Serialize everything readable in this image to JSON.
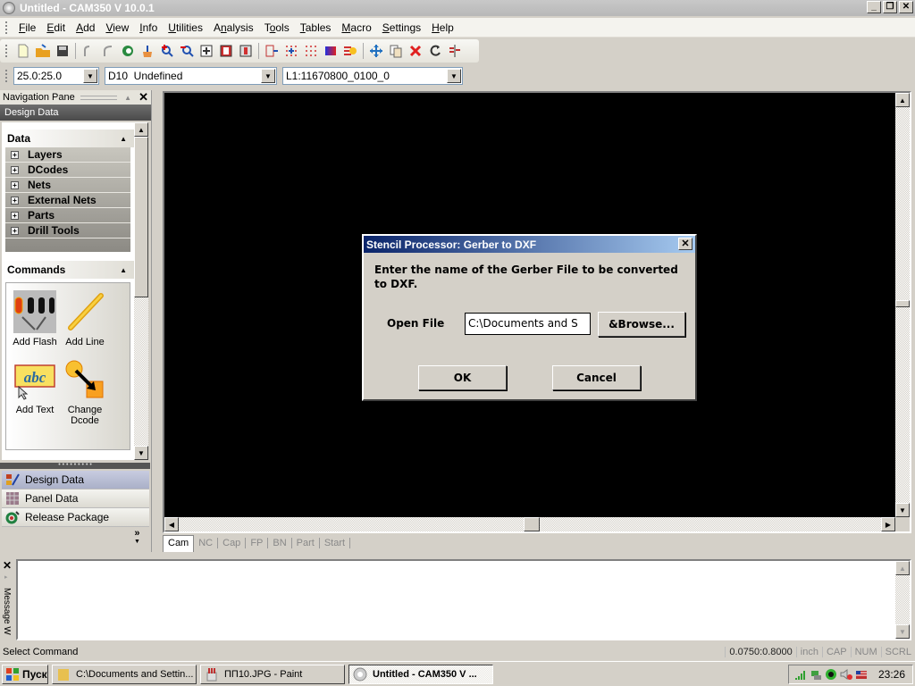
{
  "window": {
    "title": "Untitled - CAM350 V 10.0.1",
    "controls": {
      "minimize": "_",
      "restore": "❐",
      "close": "✕"
    }
  },
  "menu": [
    {
      "label": "File",
      "accel": "F"
    },
    {
      "label": "Edit",
      "accel": "E"
    },
    {
      "label": "Add",
      "accel": "A"
    },
    {
      "label": "View",
      "accel": "V"
    },
    {
      "label": "Info",
      "accel": "I"
    },
    {
      "label": "Utilities",
      "accel": "U"
    },
    {
      "label": "Analysis",
      "accel": "n"
    },
    {
      "label": "Tools",
      "accel": "o"
    },
    {
      "label": "Tables",
      "accel": "T"
    },
    {
      "label": "Macro",
      "accel": "M"
    },
    {
      "label": "Settings",
      "accel": "S"
    },
    {
      "label": "Help",
      "accel": "H"
    }
  ],
  "toolbar": {
    "icons": [
      "new-file",
      "open-folder",
      "save",
      "undo",
      "redo",
      "redraw",
      "erase",
      "zoom-in",
      "zoom-out",
      "zoom-window",
      "zoom-all",
      "zoom-previous",
      "snap-toggle",
      "grid-dots",
      "grid-dense",
      "color-layers",
      "flash-lines",
      "move",
      "copy",
      "delete",
      "rotate",
      "mirror"
    ]
  },
  "combos": {
    "grid": "25.0:25.0",
    "dcode": "D10  Undefined",
    "layer": "L1:11670800_0100_0"
  },
  "nav_pane": {
    "title": "Navigation Pane",
    "section_title": "Design Data",
    "data_header": "Data",
    "data_items": [
      "Layers",
      "DCodes",
      "Nets",
      "External Nets",
      "Parts",
      "Drill Tools"
    ],
    "commands_header": "Commands",
    "commands": [
      {
        "label": "Add Flash",
        "icon": "add-flash"
      },
      {
        "label": "Add Line",
        "icon": "add-line"
      },
      {
        "label": "Add Text",
        "icon": "add-text"
      },
      {
        "label": "Change Dcode",
        "icon": "change-dcode"
      }
    ],
    "nav_buttons": [
      {
        "label": "Design Data",
        "active": true
      },
      {
        "label": "Panel Data",
        "active": false
      },
      {
        "label": "Release Package",
        "active": false
      }
    ],
    "more": "»"
  },
  "tabs": [
    {
      "label": "Cam",
      "active": true
    },
    {
      "label": "NC",
      "active": false
    },
    {
      "label": "Cap",
      "active": false
    },
    {
      "label": "FP",
      "active": false
    },
    {
      "label": "BN",
      "active": false
    },
    {
      "label": "Part",
      "active": false
    },
    {
      "label": "Start",
      "active": false
    }
  ],
  "message_window": {
    "title": "Message W",
    "close": "✕"
  },
  "status": {
    "text": "Select Command",
    "coords": "0.0750:0.8000",
    "units": "inch",
    "cap": "CAP",
    "num": "NUM",
    "scrl": "SCRL"
  },
  "dialog": {
    "title": "Stencil Processor: Gerber to DXF",
    "message": "Enter the name of the Gerber File to be converted to DXF.",
    "field_label": "Open File",
    "field_value": "C:\\Documents and S",
    "browse": "&Browse...",
    "ok": "OK",
    "cancel": "Cancel"
  },
  "taskbar": {
    "start": "Пуск",
    "tasks": [
      {
        "label": "C:\\Documents and Settin...",
        "active": false
      },
      {
        "label": "ПП10.JPG - Paint",
        "active": false
      },
      {
        "label": "Untitled - CAM350 V ...",
        "active": true
      }
    ],
    "clock": "23:26"
  }
}
